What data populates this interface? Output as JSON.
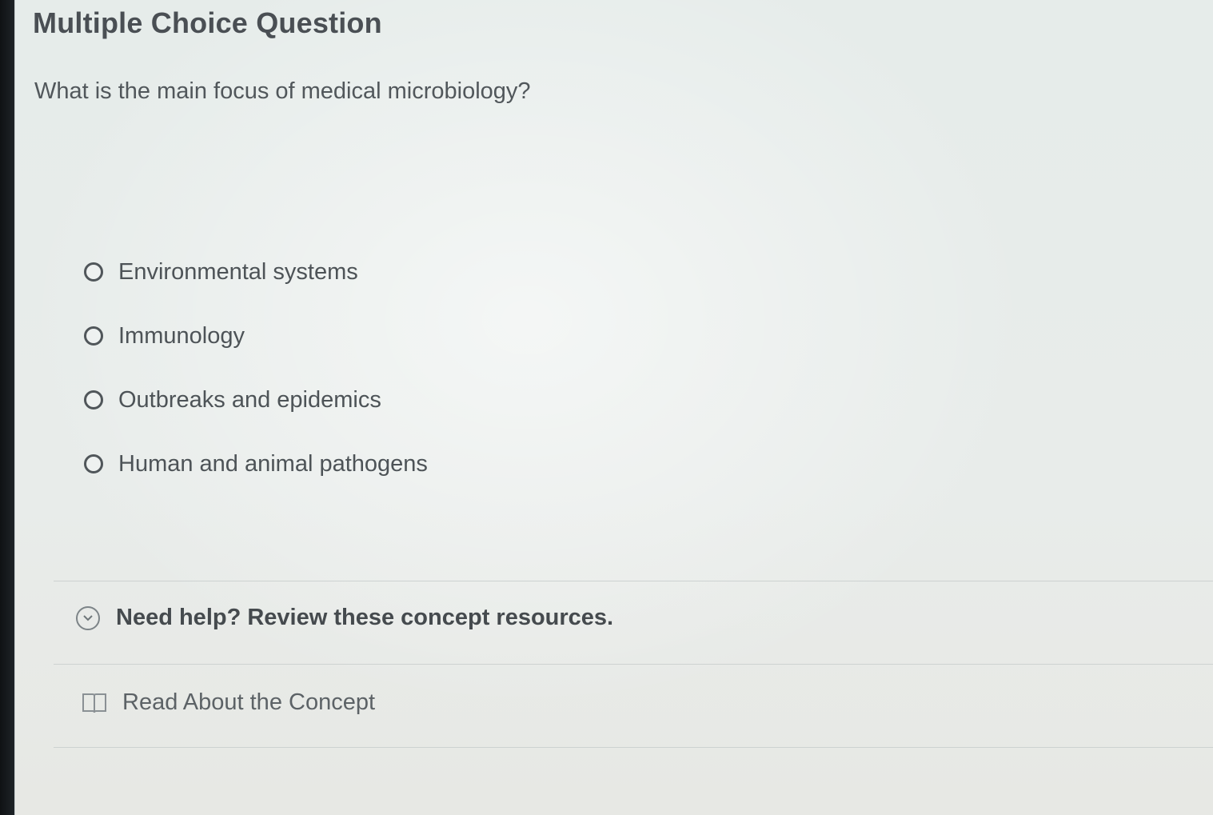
{
  "question": {
    "type_label": "Multiple Choice Question",
    "prompt": "What is the main focus of medical microbiology?"
  },
  "options": [
    {
      "label": "Environmental systems",
      "selected": false
    },
    {
      "label": "Immunology",
      "selected": false
    },
    {
      "label": "Outbreaks and epidemics",
      "selected": false
    },
    {
      "label": "Human and animal pathogens",
      "selected": false
    }
  ],
  "help": {
    "toggle_label": "Need help? Review these concept resources.",
    "toggle_icon": "chevron-down-circle-icon"
  },
  "resources": [
    {
      "label": "Read About the Concept",
      "icon": "book-icon"
    }
  ],
  "colors": {
    "page_background": "#e9eceb",
    "text": "#4a4f54",
    "divider": "#cdd2d1"
  }
}
